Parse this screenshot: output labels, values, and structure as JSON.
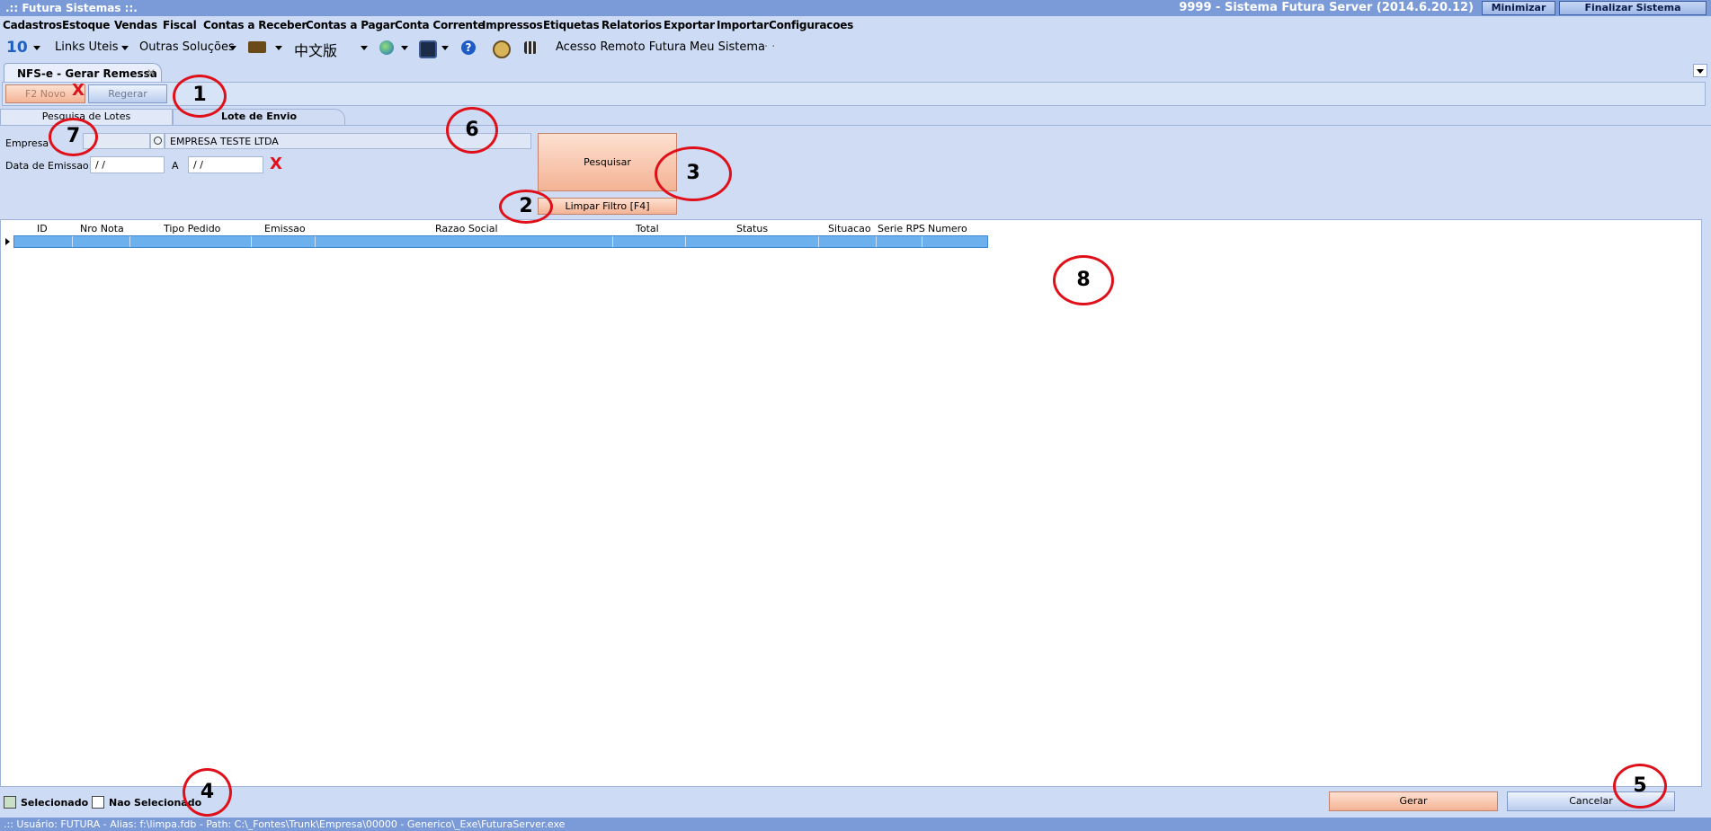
{
  "window": {
    "app_title": ".:: Futura Sistemas ::.",
    "server_title": "9999 - Sistema Futura Server (2014.6.20.12)",
    "minimize_label": "Minimizar",
    "exit_label": "Finalizar Sistema"
  },
  "menu": [
    "Cadastros",
    "Estoque",
    "Vendas",
    "Fiscal",
    "Contas a Receber",
    "Contas a Pagar",
    "Conta Corrente",
    "Impressos",
    "Etiquetas",
    "Relatorios",
    "Exportar",
    "Importar",
    "Configuracoes"
  ],
  "toolbar": {
    "version_badge": "10",
    "links_label": "Links Uteis",
    "solutions_label": "Outras Soluções",
    "chinese_label": "中文版",
    "remote_label": "Acesso Remoto Futura",
    "my_system_label": "Meu Sistema",
    "trailing_dots": "·     ·"
  },
  "doc_tab": {
    "label": "NFS-e - Gerar Remessa",
    "close": "✕"
  },
  "actions": {
    "new_label": "F2 Novo",
    "regen_label": "Regerar"
  },
  "tabs": {
    "batch_search": "Pesquisa de Lotes",
    "send_batch": "Lote de Envio"
  },
  "filter": {
    "company_label": "Empresa",
    "company_name": "EMPRESA TESTE LTDA",
    "date_label": "Data de Emissao:",
    "date_from": " / /",
    "date_to_label": "A",
    "date_to": " / /",
    "search_label": "Pesquisar",
    "clear_label": "Limpar Filtro [F4]"
  },
  "grid": {
    "columns": [
      "ID",
      "Nro Nota",
      "Tipo Pedido",
      "Emissao",
      "Razao Social",
      "Total",
      "Status",
      "Situacao",
      "Serie RPS",
      "Numero RPS"
    ]
  },
  "legend": {
    "selected": "Selecionado",
    "not_selected": "Nao Selecionado"
  },
  "footer": {
    "generate_label": "Gerar",
    "cancel_label": "Cancelar"
  },
  "status_bar": ".:: Usuário: FUTURA - Alias: f:\\limpa.fdb - Path: C:\\_Fontes\\Trunk\\Empresa\\00000 - Generico\\_Exe\\FuturaServer.exe",
  "annotations": [
    "1",
    "2",
    "3",
    "4",
    "5",
    "6",
    "7",
    "8"
  ],
  "clear_mark": "X",
  "colors": {
    "accent": "#7a9ad8",
    "callout": "#e0101a",
    "selection": "#6cb0ee"
  }
}
